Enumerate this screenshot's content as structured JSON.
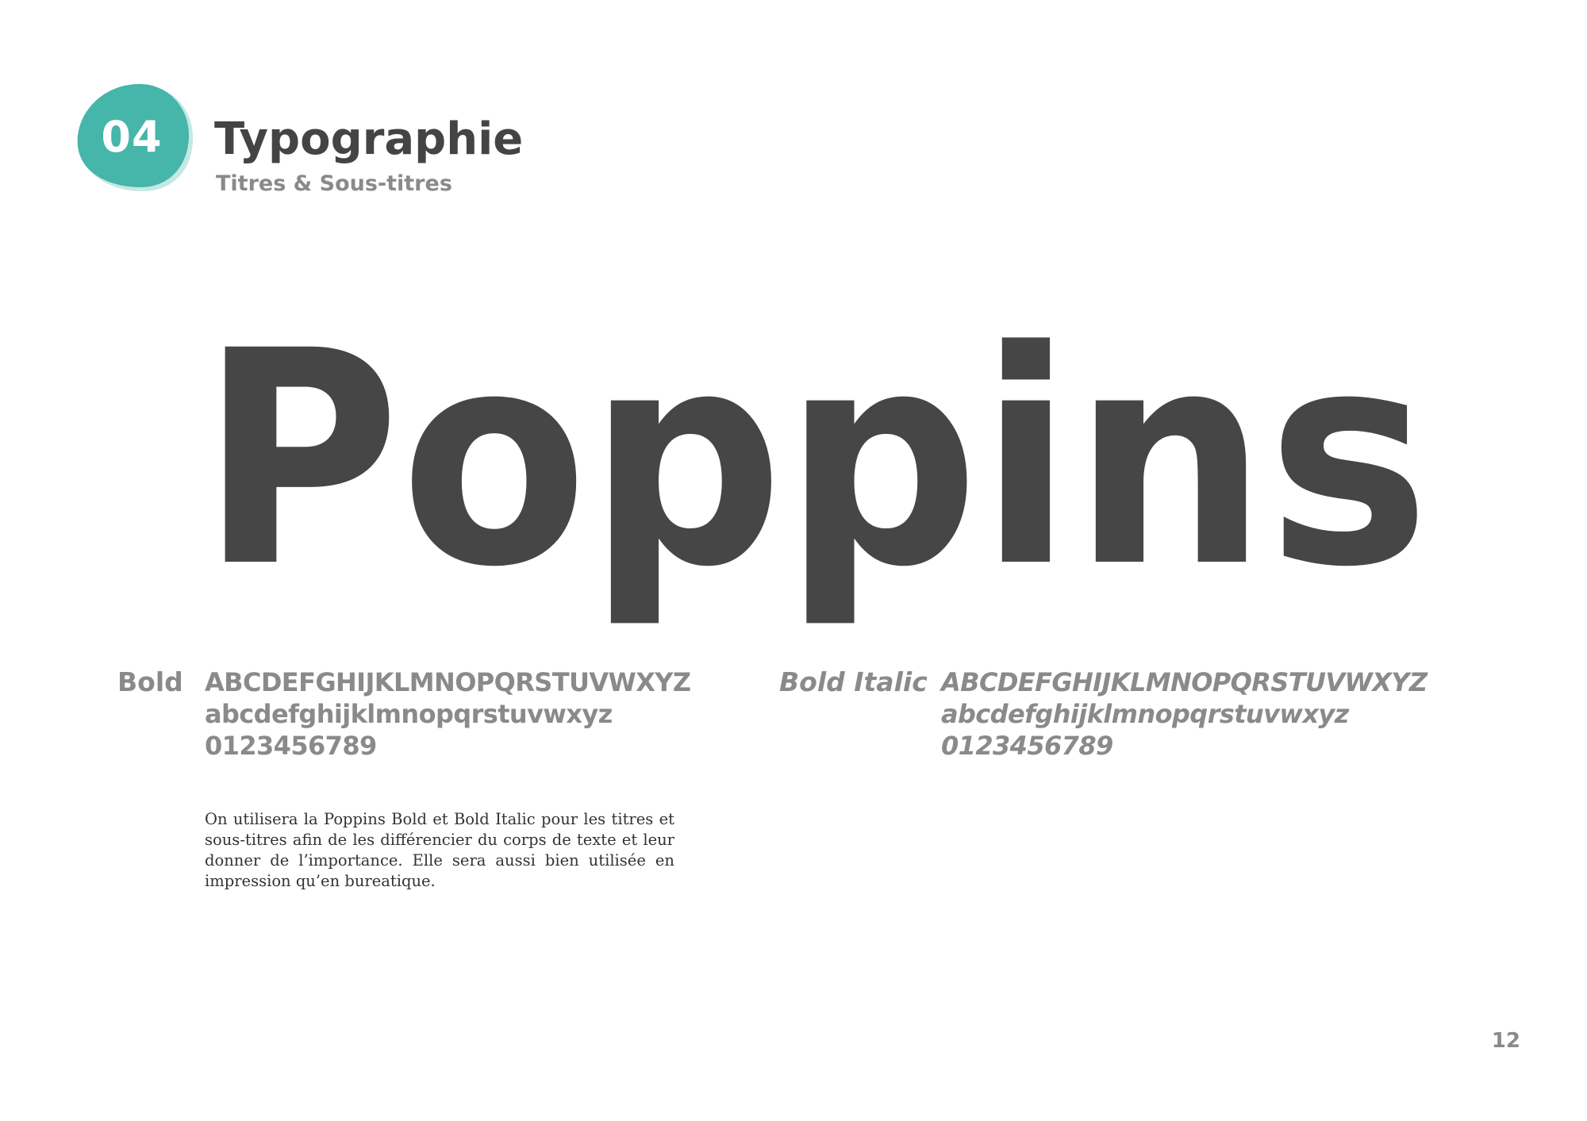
{
  "header": {
    "section_number": "04",
    "title": "Typographie",
    "subtitle": "Titres & Sous-titres",
    "accent_color": "#46b5aa"
  },
  "specimen": {
    "font_name": "Poppins",
    "text_color": "#464646"
  },
  "weights": [
    {
      "label": "Bold",
      "style": "normal",
      "lines": [
        "ABCDEFGHIJKLMNOPQRSTUVWXYZ",
        "abcdefghijklmnopqrstuvwxyz",
        "0123456789"
      ]
    },
    {
      "label": "Bold Italic",
      "style": "italic",
      "lines": [
        "ABCDEFGHIJKLMNOPQRSTUVWXYZ",
        "abcdefghijklmnopqrstuvwxyz",
        "0123456789"
      ]
    }
  ],
  "description": "On utilisera la Poppins Bold et Bold Italic pour les titres et sous-titres afin de les différencier du corps de texte et leur donner de l’importance. Elle sera aussi bien utilisée en impression qu’en bureatique.",
  "page_number": "12"
}
